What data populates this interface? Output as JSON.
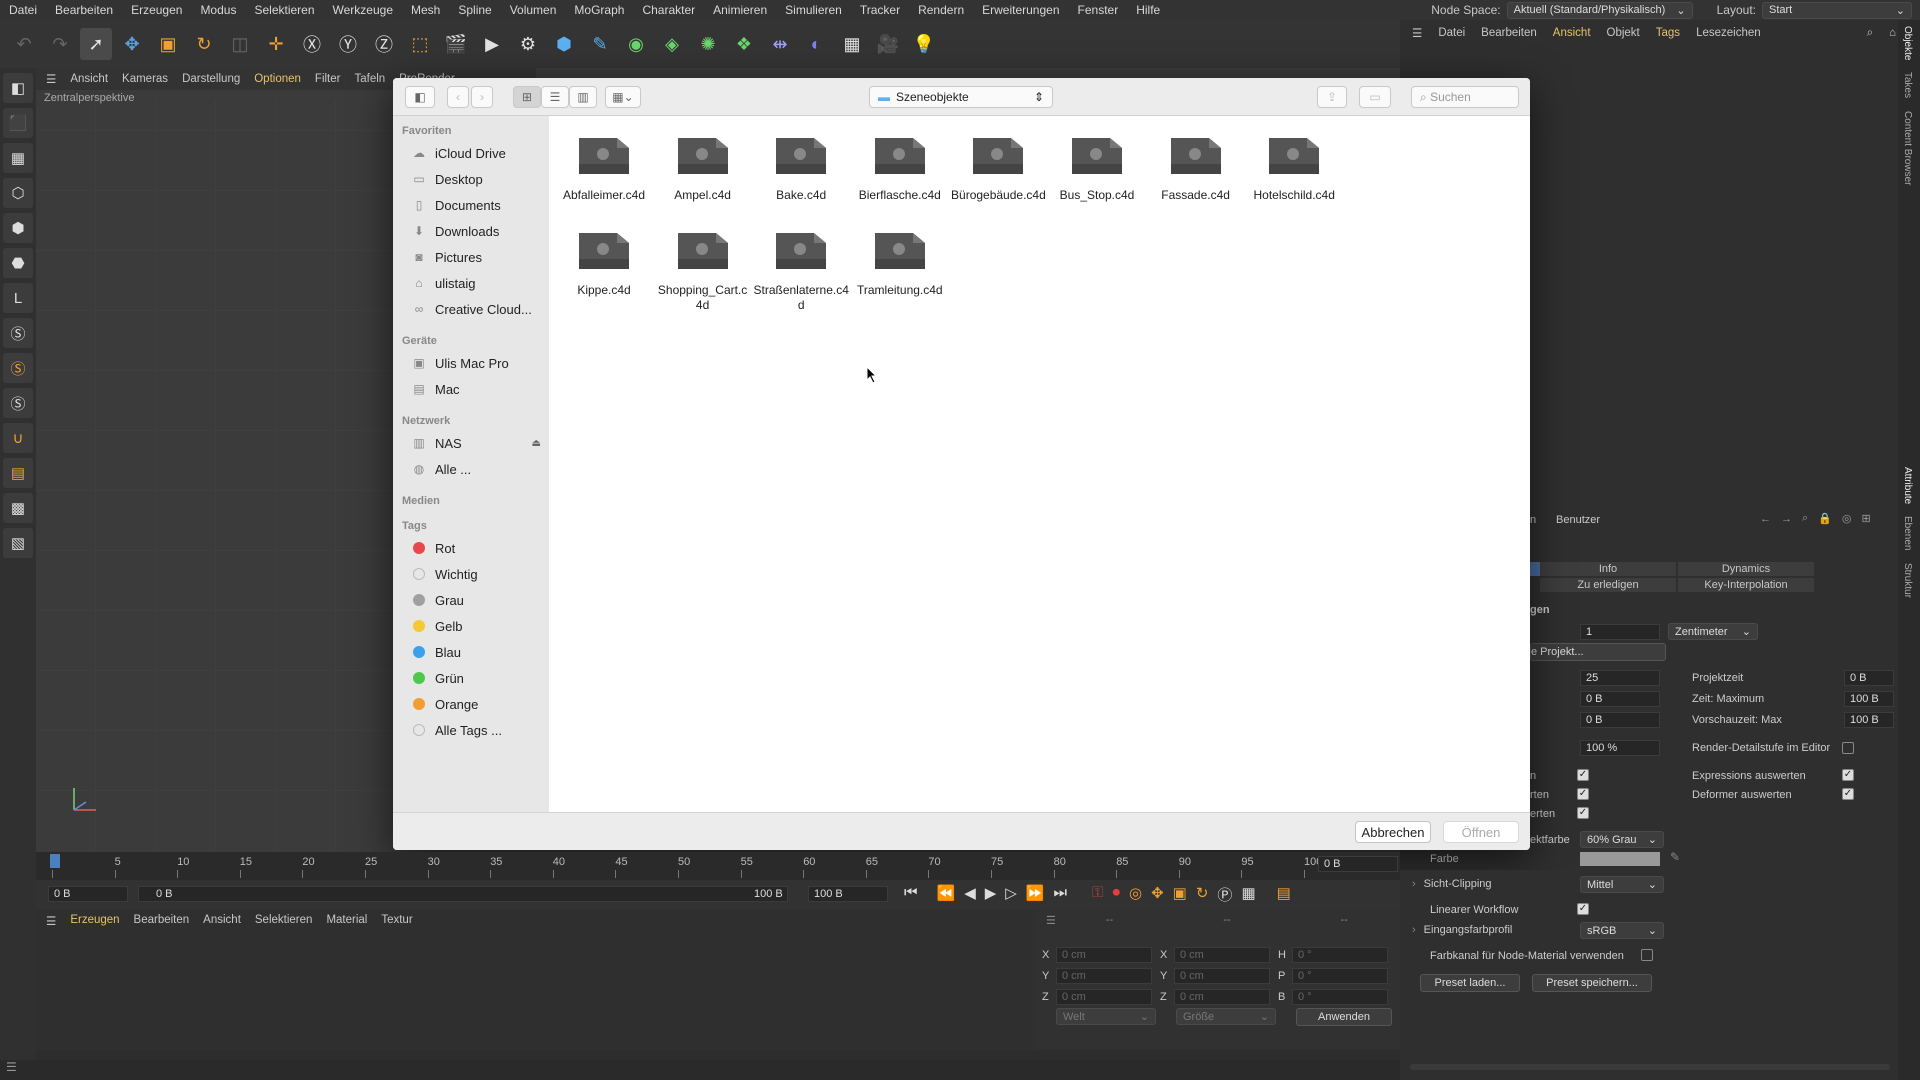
{
  "menubar": [
    "Datei",
    "Bearbeiten",
    "Erzeugen",
    "Modus",
    "Selektieren",
    "Werkzeuge",
    "Mesh",
    "Spline",
    "Volumen",
    "MoGraph",
    "Charakter",
    "Animieren",
    "Simulieren",
    "Tracker",
    "Rendern",
    "Erweiterungen",
    "Fenster",
    "Hilfe"
  ],
  "node_space": {
    "label": "Node Space:",
    "value": "Aktuell (Standard/Physikalisch)"
  },
  "layout": {
    "label": "Layout:",
    "value": "Start"
  },
  "viewport": {
    "menu": [
      "Ansicht",
      "Kameras",
      "Darstellung",
      "Optionen",
      "Filter",
      "Tafeln",
      "ProRender"
    ],
    "title": "Zentralperspektive"
  },
  "objmenu": [
    "Datei",
    "Bearbeiten",
    "Ansicht",
    "Objekt",
    "Tags",
    "Lesezeichen"
  ],
  "side_tabs": [
    "Objekte",
    "Takes",
    "Content Browser",
    "Attribute",
    "Ebenen",
    "Struktur"
  ],
  "dialog": {
    "folder": "Szeneobjekte",
    "search_placeholder": "Suchen",
    "sections": {
      "favorites": {
        "title": "Favoriten",
        "items": [
          "iCloud Drive",
          "Desktop",
          "Documents",
          "Downloads",
          "Pictures",
          "ulistaig",
          "Creative Cloud..."
        ]
      },
      "devices": {
        "title": "Geräte",
        "items": [
          "Ulis Mac Pro",
          "Mac"
        ]
      },
      "network": {
        "title": "Netzwerk",
        "items": [
          "NAS",
          "Alle ..."
        ]
      },
      "media": {
        "title": "Medien"
      },
      "tags": {
        "title": "Tags",
        "items": [
          {
            "label": "Rot",
            "color": "#e8474b"
          },
          {
            "label": "Wichtig",
            "color": "#d8d8d8"
          },
          {
            "label": "Grau",
            "color": "#a0a0a0"
          },
          {
            "label": "Gelb",
            "color": "#f5c932"
          },
          {
            "label": "Blau",
            "color": "#3ba1e8"
          },
          {
            "label": "Grün",
            "color": "#4cc94a"
          },
          {
            "label": "Orange",
            "color": "#f39c34"
          },
          {
            "label": "Alle Tags ...",
            "color": "#d8d8d8"
          }
        ]
      }
    },
    "files": [
      "Abfalleimer.c4d",
      "Ampel.c4d",
      "Bake.c4d",
      "Bierflasche.c4d",
      "Bürogebäude.c4d",
      "Bus_Stop.c4d",
      "Fassade.c4d",
      "Hotelschild.c4d",
      "Kippe.c4d",
      "Shopping_Cart.c4d",
      "Straßenlaterne.c4d",
      "Tramleitung.c4d"
    ],
    "cancel": "Abbrechen",
    "open": "Öffnen"
  },
  "timeline": {
    "ticks": [
      "0",
      "5",
      "10",
      "15",
      "20",
      "25",
      "30",
      "35",
      "40",
      "45",
      "50",
      "55",
      "60",
      "65",
      "70",
      "75",
      "80",
      "85",
      "90",
      "95",
      "100"
    ],
    "frame_right": "0 B",
    "start": "0 B",
    "start2": "0 B",
    "end": "100 B",
    "end2": "100 B"
  },
  "material_menu": [
    "Erzeugen",
    "Bearbeiten",
    "Ansicht",
    "Selektieren",
    "Material",
    "Textur"
  ],
  "coords": {
    "dash1": "--",
    "dash2": "--",
    "dash3": "--",
    "rows": [
      [
        "X",
        "0 cm",
        "X",
        "0 cm",
        "H",
        "0 °"
      ],
      [
        "Y",
        "0 cm",
        "Y",
        "0 cm",
        "P",
        "0 °"
      ],
      [
        "Z",
        "0 cm",
        "Z",
        "0 cm",
        "B",
        "0 °"
      ]
    ],
    "world": "Welt",
    "size": "Größe",
    "apply": "Anwenden"
  },
  "attributes": {
    "header": "Benutzer",
    "tab_fragment": "n",
    "tabs": [
      "Info",
      "Dynamics",
      "Zu erledigen",
      "Key-Interpolation"
    ],
    "section_fragment": "gen",
    "scale_value": "1",
    "unit": "Zentimeter",
    "project_btn": "e Projekt...",
    "fps": "25",
    "projektzeit": {
      "label": "Projektzeit",
      "value": "0 B"
    },
    "min": "0 B",
    "zeit_max": {
      "label": "Zeit: Maximum",
      "value": "100 B"
    },
    "min2": "0 B",
    "vorschau_max": {
      "label": "Vorschauzeit: Max",
      "value": "100 B"
    },
    "lod": "100 %",
    "render_detail": "Render-Detailstufe im Editor",
    "left_frag": [
      "n",
      "rten",
      "erten"
    ],
    "expressions": "Expressions auswerten",
    "deformer": "Deformer auswerten",
    "objektfarbe": {
      "label": "ektfarbe",
      "value": "60% Grau"
    },
    "farbe": "Farbe",
    "sicht": {
      "label": "Sicht-Clipping",
      "value": "Mittel"
    },
    "linear": "Linearer Workflow",
    "eingang": {
      "label": "Eingangsfarbprofil",
      "value": "sRGB"
    },
    "farbkanal": "Farbkanal für Node-Material verwenden",
    "preset_load": "Preset laden...",
    "preset_save": "Preset speichern..."
  }
}
